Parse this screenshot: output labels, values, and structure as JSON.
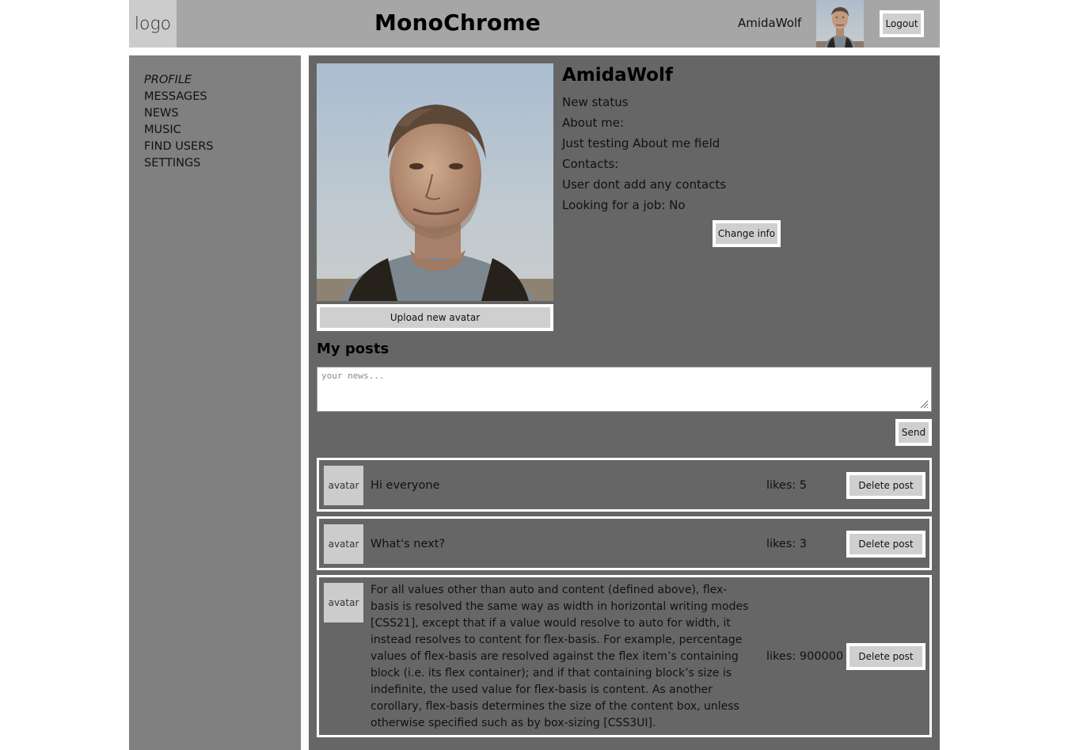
{
  "header": {
    "logo": "logo",
    "title": "MonoChrome",
    "username": "AmidaWolf",
    "logout_label": "Logout"
  },
  "sidebar": {
    "items": [
      {
        "label": "PROFILE",
        "active": true
      },
      {
        "label": "MESSAGES",
        "active": false
      },
      {
        "label": "NEWS",
        "active": false
      },
      {
        "label": "MUSIC",
        "active": false
      },
      {
        "label": "FIND USERS",
        "active": false
      },
      {
        "label": "SETTINGS",
        "active": false
      }
    ]
  },
  "profile": {
    "name": "AmidaWolf",
    "status": "New status",
    "about_label": "About me:",
    "about_text": "Just testing About me field",
    "contacts_label": "Contacts:",
    "contacts_text": "User dont add any contacts",
    "job": "Looking for a job: No",
    "change_info_label": "Change info",
    "upload_avatar_label": "Upload new avatar"
  },
  "posts_section": {
    "title": "My posts",
    "input_placeholder": "your news...",
    "send_label": "Send",
    "delete_label": "Delete post",
    "avatar_label": "avatar",
    "posts": [
      {
        "text": "Hi everyone",
        "likes": "likes: 5"
      },
      {
        "text": "What's next?",
        "likes": "likes: 3"
      },
      {
        "text": "For all values other than auto and content (defined above), flex-basis is resolved the same way as width in horizontal writing modes [CSS21], except that if a value would resolve to auto for width, it instead resolves to content for flex-basis. For example, percentage values of flex-basis are resolved against the flex item’s containing block (i.e. its flex container); and if that containing block’s size is indefinite, the used value for flex-basis is content. As another corollary, flex-basis determines the size of the content box, unless otherwise specified such as by box-sizing [CSS3UI].",
        "likes": "likes: 900000"
      }
    ]
  },
  "colors": {
    "header_bg": "#a6a6a6",
    "sidebar_bg": "#808080",
    "main_bg": "#666666",
    "button_bg": "#cfcfcf",
    "placeholder_bg": "#cccccc"
  }
}
